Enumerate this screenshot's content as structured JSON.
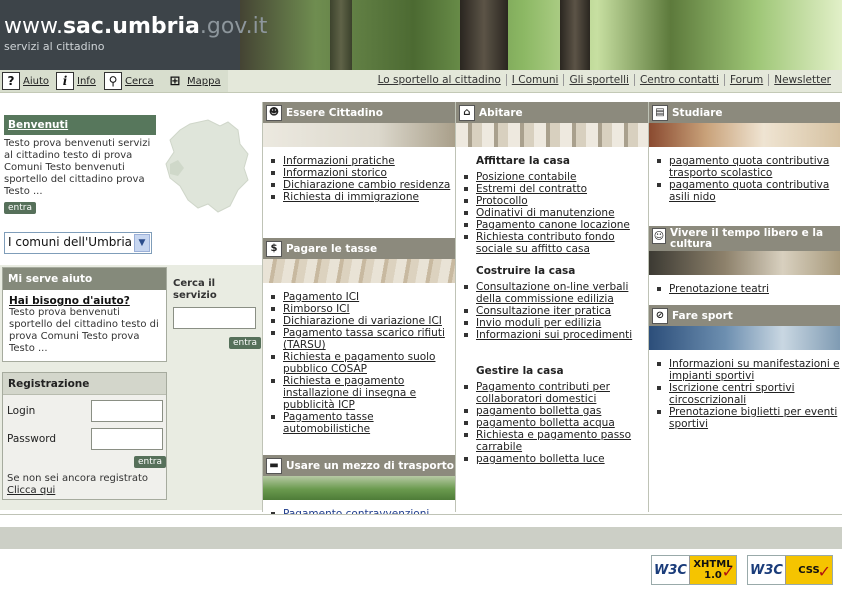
{
  "header": {
    "site_prefix": "www.",
    "site_domain": "sac.umbria",
    "site_suffix": ".gov.it",
    "subtitle": "servizi al cittadino"
  },
  "toolbar": {
    "tools": [
      {
        "label": "Aiuto",
        "icon": "help-icon"
      },
      {
        "label": "Info",
        "icon": "info-icon"
      },
      {
        "label": "Cerca",
        "icon": "search-icon"
      },
      {
        "label": "Mappa",
        "icon": "sitemap-icon"
      }
    ],
    "links": [
      "Lo sportello al cittadino",
      "I Comuni",
      "Gli sportelli",
      "Centro contatti",
      "Forum",
      "Newsletter"
    ]
  },
  "welcome": {
    "title": "Benvenuti",
    "text": "Testo prova benvenuti servizi al cittadino testo di prova Comuni Testo benvenuti sportello del cittadino prova Testo ...",
    "button": "entra"
  },
  "comuni_select": {
    "value": "I comuni dell'Umbria"
  },
  "help": {
    "title": "Mi serve aiuto",
    "question": "Hai bisogno d'aiuto?",
    "text": "Testo prova benvenuti sportello del cittadino testo di prova Comuni Testo prova Testo ..."
  },
  "search": {
    "title": "Cerca il servizio",
    "button": "entra"
  },
  "registration": {
    "title": "Registrazione",
    "login_label": "Login",
    "password_label": "Password",
    "button": "entra",
    "note": "Se non sei ancora registrato",
    "link": "Clicca qui"
  },
  "sections": {
    "essere_cittadino": {
      "title": "Essere Cittadino",
      "items": [
        "Informazioni pratiche",
        "Informazioni storico",
        "Dichiarazione cambio residenza",
        "Richiesta di immigrazione"
      ]
    },
    "pagare_tasse": {
      "title": "Pagare le tasse",
      "items": [
        "Pagamento ICI",
        "Rimborso ICI",
        "Dichiarazione di variazione ICI",
        "Pagamento tassa scarico rifiuti (TARSU)",
        "Richiesta e pagamento suolo pubblico COSAP",
        "Richiesta e pagamento installazione di insegna e pubblicità ICP",
        "Pagamento tasse automobilistiche"
      ]
    },
    "trasporto": {
      "title": "Usare un mezzo di trasporto",
      "items": [
        "Pagamento contravvenzioni"
      ]
    },
    "abitare": {
      "title": "Abitare",
      "groups": [
        {
          "title": "Affittare la casa",
          "items": [
            "Posizione contabile",
            "Estremi del contratto",
            "Protocollo",
            "Odinativi di manutenzione",
            "Pagamento canone locazione",
            "Richiesta contributo fondo sociale su affitto casa"
          ]
        },
        {
          "title": "Costruire la casa",
          "items": [
            "Consultazione on-line verbali della commissione edilizia",
            "Consultazione iter pratica",
            "Invio moduli per edilizia",
            "Informazioni sui procedimenti"
          ]
        },
        {
          "title": "Gestire la casa",
          "items": [
            "Pagamento contributi per collaboratori domestici",
            "pagamento bolletta gas",
            "pagamento bolletta acqua",
            "Richiesta e pagamento passo carrabile",
            "pagamento bolletta luce"
          ]
        }
      ]
    },
    "studiare": {
      "title": "Studiare",
      "items": [
        "pagamento quota contributiva trasporto scolastico",
        "pagamento quota contributiva asili nido"
      ]
    },
    "tempo_libero": {
      "title": "Vivere il tempo libero e la cultura",
      "items": [
        "Prenotazione teatri"
      ]
    },
    "sport": {
      "title": "Fare sport",
      "items": [
        "Informazioni su manifestazioni e impianti sportivi",
        "Iscrizione centri sportivi circoscrizionali",
        "Prenotazione biglietti per eventi sportivi"
      ]
    }
  },
  "footer": {
    "badges": [
      {
        "w3c": "W3C",
        "label1": "XHTML",
        "label2": "1.0"
      },
      {
        "w3c": "W3C",
        "label1": "CSS",
        "label2": ""
      }
    ]
  }
}
